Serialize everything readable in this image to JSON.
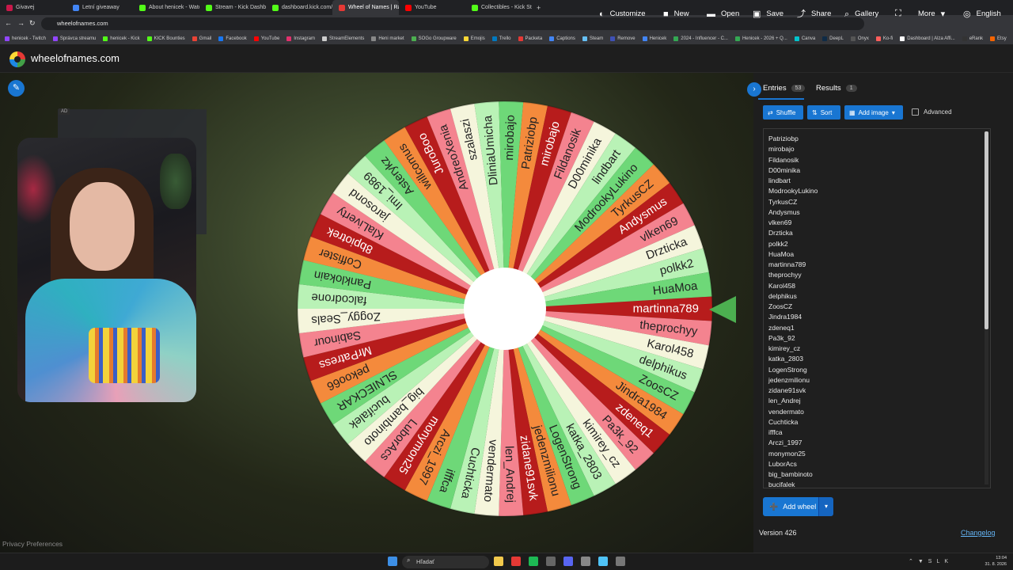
{
  "browser": {
    "tabs": [
      {
        "label": "Givavej",
        "color": "#c9184a",
        "active": false
      },
      {
        "label": "Letní giveaway",
        "color": "#4285f4",
        "active": false
      },
      {
        "label": "About henicek - Watch Li",
        "color": "#53fc18",
        "active": false
      },
      {
        "label": "Stream - Kick Dashboard",
        "color": "#53fc18",
        "active": false
      },
      {
        "label": "dashboard.kick.com/pop",
        "color": "#53fc18",
        "active": false
      },
      {
        "label": "Wheel of Names | Rando",
        "color": "#e53935",
        "active": true
      },
      {
        "label": "YouTube",
        "color": "#ff0000",
        "active": false
      },
      {
        "label": "Collectibles - Kick Stream",
        "color": "#53fc18",
        "active": false
      }
    ],
    "url": "wheelofnames.com",
    "bookmarks": [
      {
        "label": "henicek - Twitch",
        "color": "#9146ff"
      },
      {
        "label": "Správca streamu",
        "color": "#9146ff"
      },
      {
        "label": "henicek - Kick",
        "color": "#53fc18"
      },
      {
        "label": "KICK Bounties",
        "color": "#53fc18"
      },
      {
        "label": "Gmail",
        "color": "#ea4335"
      },
      {
        "label": "Facebook",
        "color": "#1877f2"
      },
      {
        "label": "YouTube",
        "color": "#ff0000"
      },
      {
        "label": "Instagram",
        "color": "#e1306c"
      },
      {
        "label": "StreamElements",
        "color": "#cccccc"
      },
      {
        "label": "Heni market",
        "color": "#888888"
      },
      {
        "label": "SOGo Groupware",
        "color": "#4caf50"
      },
      {
        "label": "Emojis",
        "color": "#fdd835"
      },
      {
        "label": "Trello",
        "color": "#0079bf"
      },
      {
        "label": "Packeta",
        "color": "#e53935"
      },
      {
        "label": "Captions",
        "color": "#4285f4"
      },
      {
        "label": "Steam",
        "color": "#66c0f4"
      },
      {
        "label": "Remove",
        "color": "#3f51b5"
      },
      {
        "label": "Henicek",
        "color": "#4285f4"
      },
      {
        "label": "2024 - Influencer - C...",
        "color": "#34a853"
      },
      {
        "label": "Henicek - 2026 + Q...",
        "color": "#34a853"
      },
      {
        "label": "Canva",
        "color": "#00c4cc"
      },
      {
        "label": "DeepL",
        "color": "#0f2b46"
      },
      {
        "label": "Onyx",
        "color": "#555555"
      },
      {
        "label": "Ko-fi",
        "color": "#ff5e5b"
      },
      {
        "label": "Dashboard | Alza Affi...",
        "color": "#ffffff"
      },
      {
        "label": "eRank",
        "color": "#333333"
      },
      {
        "label": "Etsy",
        "color": "#f56400"
      }
    ]
  },
  "header": {
    "site_title": "wheelofnames.com",
    "nav": [
      {
        "label": "Customize",
        "icon": "palette-icon",
        "glyph": "◐"
      },
      {
        "label": "New",
        "icon": "file-icon",
        "glyph": "■"
      },
      {
        "label": "Open",
        "icon": "folder-icon",
        "glyph": "▬"
      },
      {
        "label": "Save",
        "icon": "save-icon",
        "glyph": "▣"
      },
      {
        "label": "Share",
        "icon": "share-icon",
        "glyph": "⤴"
      },
      {
        "label": "Gallery",
        "icon": "search-icon",
        "glyph": "⌕"
      },
      {
        "label": "",
        "icon": "fullscreen-icon",
        "glyph": "⛶"
      },
      {
        "label": "More",
        "icon": "chevron-down-icon",
        "glyph": "▾"
      },
      {
        "label": "English",
        "icon": "globe-icon",
        "glyph": "◎"
      }
    ]
  },
  "stage": {
    "ad_label": "AD",
    "privacy_label": "Privacy Preferences"
  },
  "wheel": {
    "colors": [
      "#b71c1c",
      "#f4838f",
      "#f5f5dc",
      "#b9f2b6",
      "#6ed878",
      "#f48a3c"
    ],
    "pointer_color": "#4caf50",
    "slices": [
      "martinna789",
      "theprochyy",
      "Karol458",
      "delphikus",
      "ZoosCZ",
      "Jindra1984",
      "zdeneq1",
      "Pa3k_92",
      "kimirey_cz",
      "katka_2803",
      "LogenStrong",
      "jedenzmilionu",
      "zidane91svk",
      "len_Andrej",
      "vendermato",
      "Cuchticka",
      "ifffca",
      "Arczi_1997",
      "monymon25",
      "LuborAcs",
      "big_bambinoto",
      "bucifalek",
      "SLNIECKAR",
      "pekoo66",
      "MrPatress",
      "Sabinour",
      "Zoggy_Seals",
      "falcodrone",
      "Panklokain",
      "Coffister",
      "8bpiotrek",
      "KlaLiverty",
      "jarosond",
      "Imi_1989",
      "Asterykz",
      "willcomus",
      "JuroBoo",
      "AndreoXenia",
      "szalaszi",
      "DliniaUmicha",
      "mirobajo",
      "Patriziobp",
      "mirobajo",
      "Fildanosik",
      "D00minika",
      "lindbart",
      "ModrookyLukino",
      "TyrkusCZ",
      "Andysmus",
      "vlken69",
      "Drzticka",
      "polkk2",
      "HuaMoa"
    ]
  },
  "panel": {
    "tabs": [
      {
        "label": "Entries",
        "count": "53"
      },
      {
        "label": "Results",
        "count": "1"
      }
    ],
    "buttons": {
      "shuffle": "Shuffle",
      "sort": "Sort",
      "add_image": "Add image",
      "advanced": "Advanced"
    },
    "entries": [
      "Patriziobp",
      "mirobajo",
      "Fildanosik",
      "D00minika",
      "lindbart",
      "ModrookyLukino",
      "TyrkusCZ",
      "Andysmus",
      "vlken69",
      "Drzticka",
      "polkk2",
      "HuaMoa",
      "martinna789",
      "theprochyy",
      "Karol458",
      "delphikus",
      "ZoosCZ",
      "Jindra1984",
      "zdeneq1",
      "Pa3k_92",
      "kimirey_cz",
      "katka_2803",
      "LogenStrong",
      "jedenzmilionu",
      "zidane91svk",
      "len_Andrej",
      "vendermato",
      "Cuchticka",
      "ifffca",
      "Arczi_1997",
      "monymon25",
      "LuborAcs",
      "big_bambinoto",
      "bucifalek"
    ],
    "add_wheel": "Add wheel",
    "version": "Version 426",
    "changelog": "Changelog"
  },
  "taskbar": {
    "search_placeholder": "Hľadať",
    "clock_time": "13:04",
    "clock_date": "31. 8. 2026",
    "lang": "SLK",
    "apps": [
      {
        "icon": "windows-start-icon",
        "color": "#3d8fe6"
      },
      {
        "icon": "file-explorer-icon",
        "color": "#f2c94c"
      },
      {
        "icon": "opera-icon",
        "color": "#e53935"
      },
      {
        "icon": "spotify-icon",
        "color": "#1db954"
      },
      {
        "icon": "app-icon",
        "color": "#666666"
      },
      {
        "icon": "discord-icon",
        "color": "#5865f2"
      },
      {
        "icon": "settings-icon",
        "color": "#888888"
      },
      {
        "icon": "notepad-icon",
        "color": "#4fc3f7"
      },
      {
        "icon": "app2-icon",
        "color": "#777777"
      }
    ]
  }
}
